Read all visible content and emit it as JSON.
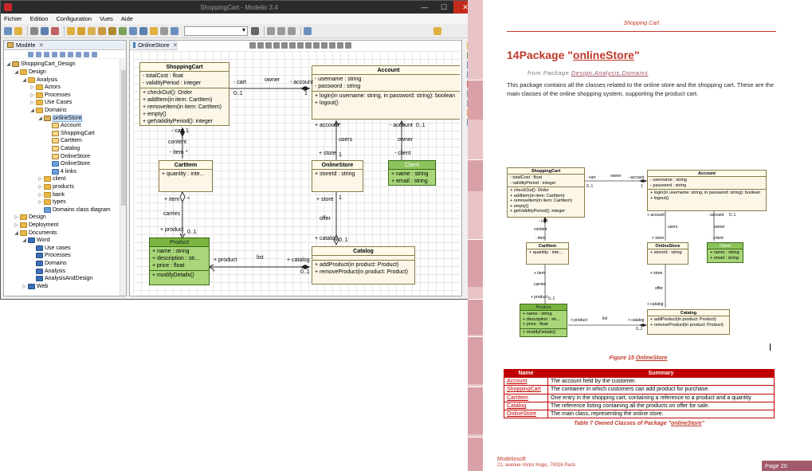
{
  "window": {
    "title": "ShoppingCart - Modelio 3.4",
    "menu": [
      "Fichier",
      "Edition",
      "Configuration",
      "Vues",
      "Aide"
    ]
  },
  "model_pane": {
    "tab_label": "Modèle",
    "tree": [
      {
        "label": "ShoppingCart_Design",
        "depth": 0,
        "icon": "project-icon",
        "expanded": true
      },
      {
        "label": "Design",
        "depth": 1,
        "icon": "folder-icon",
        "expanded": true
      },
      {
        "label": "Analysis",
        "depth": 2,
        "icon": "folder-icon",
        "expanded": true
      },
      {
        "label": "Actors",
        "depth": 3,
        "icon": "folder-icon"
      },
      {
        "label": "Processes",
        "depth": 3,
        "icon": "folder-icon"
      },
      {
        "label": "Use Cases",
        "depth": 3,
        "icon": "folder-icon"
      },
      {
        "label": "Domains",
        "depth": 3,
        "icon": "folder-icon",
        "expanded": true
      },
      {
        "label": "onlineStore",
        "depth": 4,
        "icon": "package-icon",
        "expanded": true,
        "selected": true
      },
      {
        "label": "Account",
        "depth": 5,
        "icon": "class-icon"
      },
      {
        "label": "ShoppingCart",
        "depth": 5,
        "icon": "class-icon"
      },
      {
        "label": "CartItem",
        "depth": 5,
        "icon": "class-icon"
      },
      {
        "label": "Catalog",
        "depth": 5,
        "icon": "class-icon"
      },
      {
        "label": "OnlineStore",
        "depth": 5,
        "icon": "class-icon"
      },
      {
        "label": "OnlineStore",
        "depth": 5,
        "icon": "diagram-icon"
      },
      {
        "label": "4 links",
        "depth": 5,
        "icon": "links-icon"
      },
      {
        "label": "client",
        "depth": 4,
        "icon": "folder-icon"
      },
      {
        "label": "products",
        "depth": 4,
        "icon": "folder-icon"
      },
      {
        "label": "bank",
        "depth": 4,
        "icon": "folder-icon"
      },
      {
        "label": "types",
        "depth": 4,
        "icon": "folder-icon"
      },
      {
        "label": "Domains class diagram",
        "depth": 4,
        "icon": "diagram-icon"
      },
      {
        "label": "Design",
        "depth": 1,
        "icon": "folder-icon"
      },
      {
        "label": "Deployment",
        "depth": 1,
        "icon": "folder-icon"
      },
      {
        "label": "Documents",
        "depth": 1,
        "icon": "folder-icon",
        "expanded": true
      },
      {
        "label": "Word",
        "depth": 2,
        "icon": "document-icon",
        "expanded": true
      },
      {
        "label": "Use cases",
        "depth": 3,
        "icon": "document-icon"
      },
      {
        "label": "Processes",
        "depth": 3,
        "icon": "document-icon"
      },
      {
        "label": "Domains",
        "depth": 3,
        "icon": "document-icon"
      },
      {
        "label": "Analysis",
        "depth": 3,
        "icon": "document-icon"
      },
      {
        "label": "AnalysisAndDesign",
        "depth": 3,
        "icon": "document-icon"
      },
      {
        "label": "Web",
        "depth": 2,
        "icon": "document-icon"
      }
    ]
  },
  "diagram_pane": {
    "tab_label": "OnlineStore"
  },
  "diagram": {
    "classes": {
      "shoppingcart": {
        "name": "ShoppingCart",
        "attrs": [
          "- totalCost : float",
          "- validityPeriod : integer"
        ],
        "ops": [
          "+ checkOut(): Order",
          "+ addItem(in item: CartItem)",
          "+ removeItem(in item: CartItem)",
          "+ empty()",
          "+ getValidityPeriod(): integer"
        ]
      },
      "account": {
        "name": "Account",
        "attrs": [
          "- username : string",
          "- password : string"
        ],
        "ops": [
          "+ login(in username: string, in password: string): boolean",
          "+ logout()"
        ]
      },
      "cartitem": {
        "name": "CartItem",
        "attrs": [
          "+ quantity : inte..."
        ]
      },
      "onlinestore": {
        "name": "OnlineStore",
        "attrs": [
          "+ storeId : string"
        ]
      },
      "client": {
        "name": "Client",
        "attrs": [
          "+ name : string",
          "+ email : string"
        ]
      },
      "product": {
        "name": "Product",
        "attrs": [
          "+ name : string",
          "+ description : str...",
          "+ price : float"
        ],
        "ops": [
          "+ modifyDetails()"
        ]
      },
      "catalog": {
        "name": "Catalog",
        "ops": [
          "+ addProduct(in product: Product)",
          "+ removeProduct(in product: Product)"
        ]
      }
    },
    "labels": {
      "cart": "- cart",
      "owner": "owner",
      "account": "- account",
      "one": "1",
      "zero_one": "0..1",
      "cart2": "- cart",
      "content": "content",
      "item": "- item",
      "account_p": "+ account",
      "users": "users",
      "store": "+ store",
      "account_m": "- account",
      "owner2": "owner",
      "client": "- client",
      "item_p": "+ item",
      "carries": "carries",
      "product_p": "+ product",
      "store_p": "+ store",
      "offer": "offer",
      "catalog_p": "+ catalog",
      "product_p2": "+ product",
      "list": "list",
      "catalog_p2": "+ catalog",
      "star": "*"
    }
  },
  "document": {
    "header": "Shopping Cart",
    "title_prefix": "14Package \"",
    "title_link": "onlineStore",
    "title_suffix": "\"",
    "from_text": "from Package",
    "from_link1": "Design.Analysis.",
    "from_link2": "Domains",
    "paragraph": "This package contains all the classes related to the online store and the shopping cart. These are the main classes of the online shopping system, supporting the product cart.",
    "figure_prefix": "Figure 15",
    "figure_link": "OnlineStore",
    "table_headers": [
      "Name",
      "Summary"
    ],
    "table_rows": [
      {
        "name": "Account",
        "summary": "The account held by the customer."
      },
      {
        "name": "ShoppingCart",
        "summary": "The container in which customers can add product for purchase."
      },
      {
        "name": "CartItem",
        "summary": "One entry in the shopping cart, containing a reference to a product and a quantity"
      },
      {
        "name": "Catalog",
        "summary": "The reference listing containing all the products on offer for sale."
      },
      {
        "name": "OnlineStore",
        "summary": "The main class, representing the online store."
      }
    ],
    "table_caption_prefix": "Table 7 Owned Classes of Package \"",
    "table_caption_link": "onlineStore",
    "table_caption_suffix": "\"",
    "footer_company": "Modeliosoft",
    "footer_address": "21, avenue Victor Hugo, 75016 Paris",
    "page": "Page 20"
  },
  "colors": {
    "accent": "#c0392b",
    "table_header": "#c00000",
    "class_fill": "#fbf6e6",
    "green_class": "#a8d678"
  }
}
